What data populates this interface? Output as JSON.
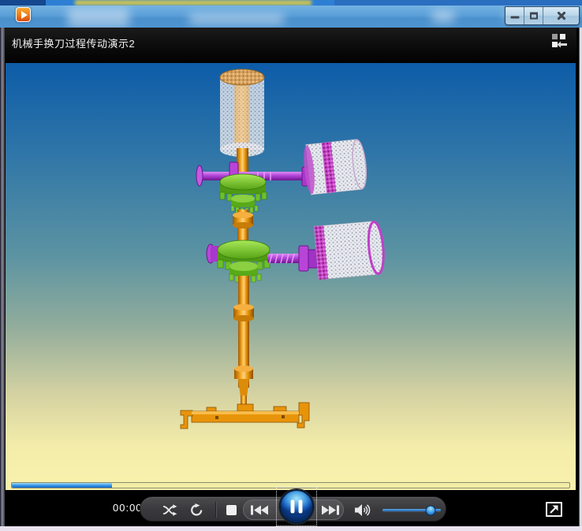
{
  "frame": {
    "window_buttons": {
      "minimize": "minimize",
      "maximize": "maximize",
      "close": "close"
    }
  },
  "player": {
    "title": "机械手换刀过程传动演示2"
  },
  "transport": {
    "elapsed_time": "00:00",
    "state": "playing",
    "progress_percent": 18,
    "volume_percent": 83
  },
  "icons": {
    "app": "orange-play-badge",
    "mini_mode": "grid-squares-left-arrow",
    "shuffle": "crossed-arrows",
    "repeat": "circular-arrow",
    "stop": "white-square",
    "previous": "bar-double-triangle-left",
    "pause": "double-white-bars",
    "next": "double-triangle-bar-right",
    "volume": "speaker-with-waves",
    "fullscreen": "box-arrow-up-right"
  },
  "colors": {
    "accent_blue": "#2f80d8",
    "progress_blue": "#3f9fe8",
    "pause_button_blue": "#1a64c4",
    "sky_top": "#0d5ca8",
    "sky_bottom": "#f9f2ad",
    "shaft_orange": "#ef9c12",
    "gear_green": "#5fb51e",
    "worm_purple": "#a93ed1",
    "cylinder_mesh": "#e9ebf0",
    "band_magenta": "#c438c8",
    "titlebar_black": "#0a0a0a"
  }
}
